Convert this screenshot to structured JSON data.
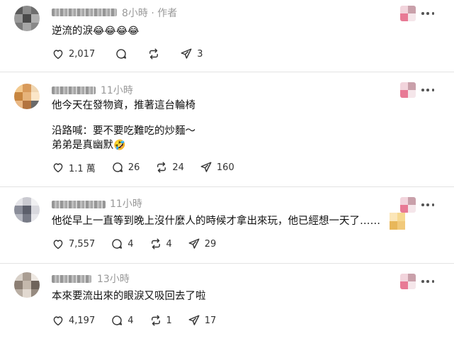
{
  "posts": [
    {
      "time": "8小時",
      "badge": "· 作者",
      "lines": [
        "逆流的淚"
      ],
      "emoji": "😂😂😂😂",
      "likes": "2,017",
      "comments": "",
      "reposts": "",
      "shares": "3"
    },
    {
      "time": "11小時",
      "lines": [
        "他今天在發物資，推著這台輪椅",
        "沿路喊：要不要吃難吃的炒麵～",
        "弟弟是真幽默"
      ],
      "emoji": "🤣",
      "likes": "1.1 萬",
      "comments": "26",
      "reposts": "24",
      "shares": "160"
    },
    {
      "time": "11小時",
      "lines": [
        "他從早上一直等到晚上沒什麼人的時候才拿出來玩，他已經想一天了……"
      ],
      "likes": "7,557",
      "comments": "4",
      "reposts": "4",
      "shares": "29"
    },
    {
      "time": "13小時",
      "lines": [
        "本來要流出來的眼淚又吸回去了啦"
      ],
      "likes": "4,197",
      "comments": "4",
      "reposts": "1",
      "shares": "17"
    }
  ],
  "icons": {
    "like": "heart-icon",
    "comment": "comment-bubble-icon",
    "repost": "repost-arrows-icon",
    "share": "share-paper-plane-icon",
    "menu": "more-dots-icon"
  },
  "colors": {
    "text": "#111111",
    "muted": "#999999",
    "divider": "#e3e3e3",
    "icon": "#333333"
  }
}
